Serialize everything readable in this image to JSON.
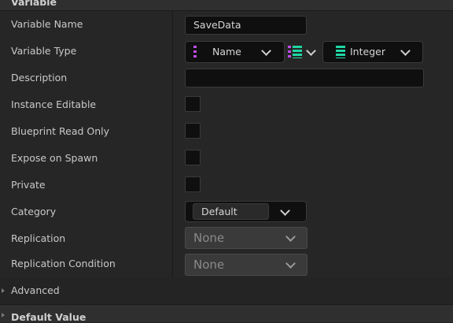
{
  "section": {
    "title": "Variable"
  },
  "rows": {
    "variable_name": {
      "label": "Variable Name",
      "value": "SaveData"
    },
    "variable_type": {
      "label": "Variable Type",
      "key_type": "Name",
      "value_type": "Integer"
    },
    "description": {
      "label": "Description",
      "value": ""
    },
    "instance_editable": {
      "label": "Instance Editable",
      "checked": false
    },
    "blueprint_read_only": {
      "label": "Blueprint Read Only",
      "checked": false
    },
    "expose_on_spawn": {
      "label": "Expose on Spawn",
      "checked": false
    },
    "private": {
      "label": "Private",
      "checked": false
    },
    "category": {
      "label": "Category",
      "value": "Default"
    },
    "replication": {
      "label": "Replication",
      "value": "None"
    },
    "replication_condition": {
      "label": "Replication Condition",
      "value": "None"
    }
  },
  "advanced": {
    "label": "Advanced"
  },
  "next_section": {
    "title": "Default Value"
  },
  "colors": {
    "background": "#242424",
    "key_pin": "#c04cf0",
    "value_pin": "#1fd6a3"
  },
  "icons": {
    "key_type": "variable-pin-icon",
    "container_type": "map-container-icon",
    "value_type": "variable-pin-icon"
  }
}
